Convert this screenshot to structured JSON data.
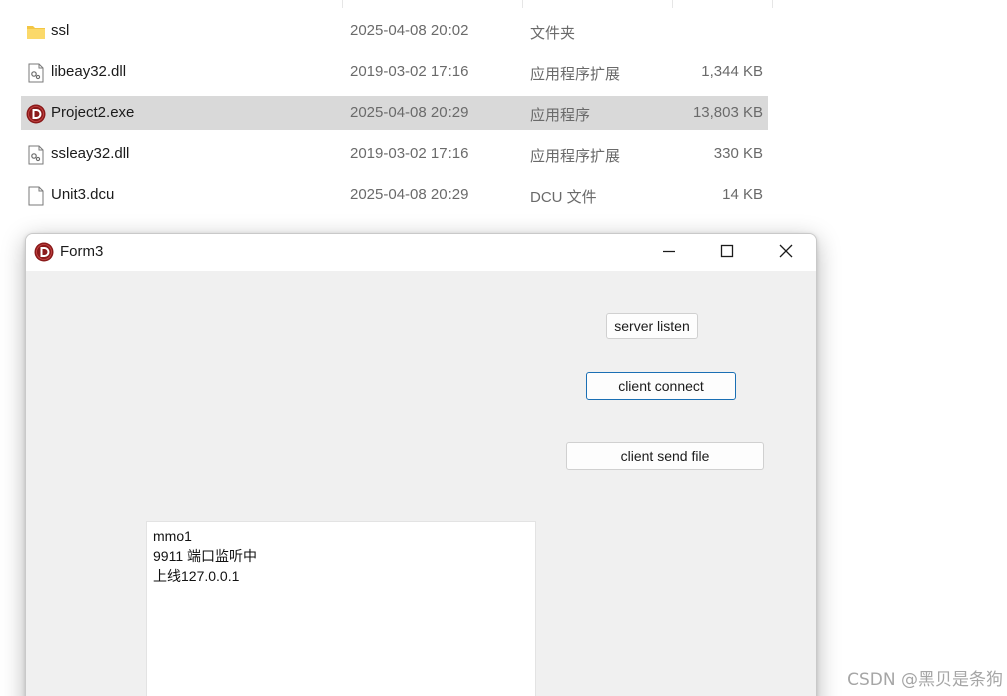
{
  "explorer": {
    "files": [
      {
        "name": "ssl",
        "date": "2025-04-08 20:02",
        "type": "文件夹",
        "size": "",
        "icon": "folder-icon",
        "selected": false
      },
      {
        "name": "libeay32.dll",
        "date": "2019-03-02 17:16",
        "type": "应用程序扩展",
        "size": "1,344 KB",
        "icon": "dll-file-icon",
        "selected": false
      },
      {
        "name": "Project2.exe",
        "date": "2025-04-08 20:29",
        "type": "应用程序",
        "size": "13,803 KB",
        "icon": "delphi-app-icon",
        "selected": true
      },
      {
        "name": "ssleay32.dll",
        "date": "2019-03-02 17:16",
        "type": "应用程序扩展",
        "size": "330 KB",
        "icon": "dll-file-icon",
        "selected": false
      },
      {
        "name": "Unit3.dcu",
        "date": "2025-04-08 20:29",
        "type": "DCU 文件",
        "size": "14 KB",
        "icon": "blank-file-icon",
        "selected": false
      }
    ]
  },
  "window": {
    "title": "Form3",
    "icon": "delphi-app-icon",
    "controls": {
      "minimize": "minimize-icon",
      "maximize": "maximize-icon",
      "close": "close-icon"
    }
  },
  "form": {
    "server_listen_label": "server listen",
    "client_connect_label": "client connect",
    "client_send_file_label": "client send file",
    "memo_lines": [
      "mmo1",
      "9911 端口监听中",
      "上线127.0.0.1"
    ]
  },
  "watermark": "CSDN @黑贝是条狗",
  "colors": {
    "selected_row": "#d9d9d9",
    "window_bg": "#f0f0f0",
    "focus_border": "#1a6fb4",
    "delphi_icon": "#8b1a1a"
  }
}
